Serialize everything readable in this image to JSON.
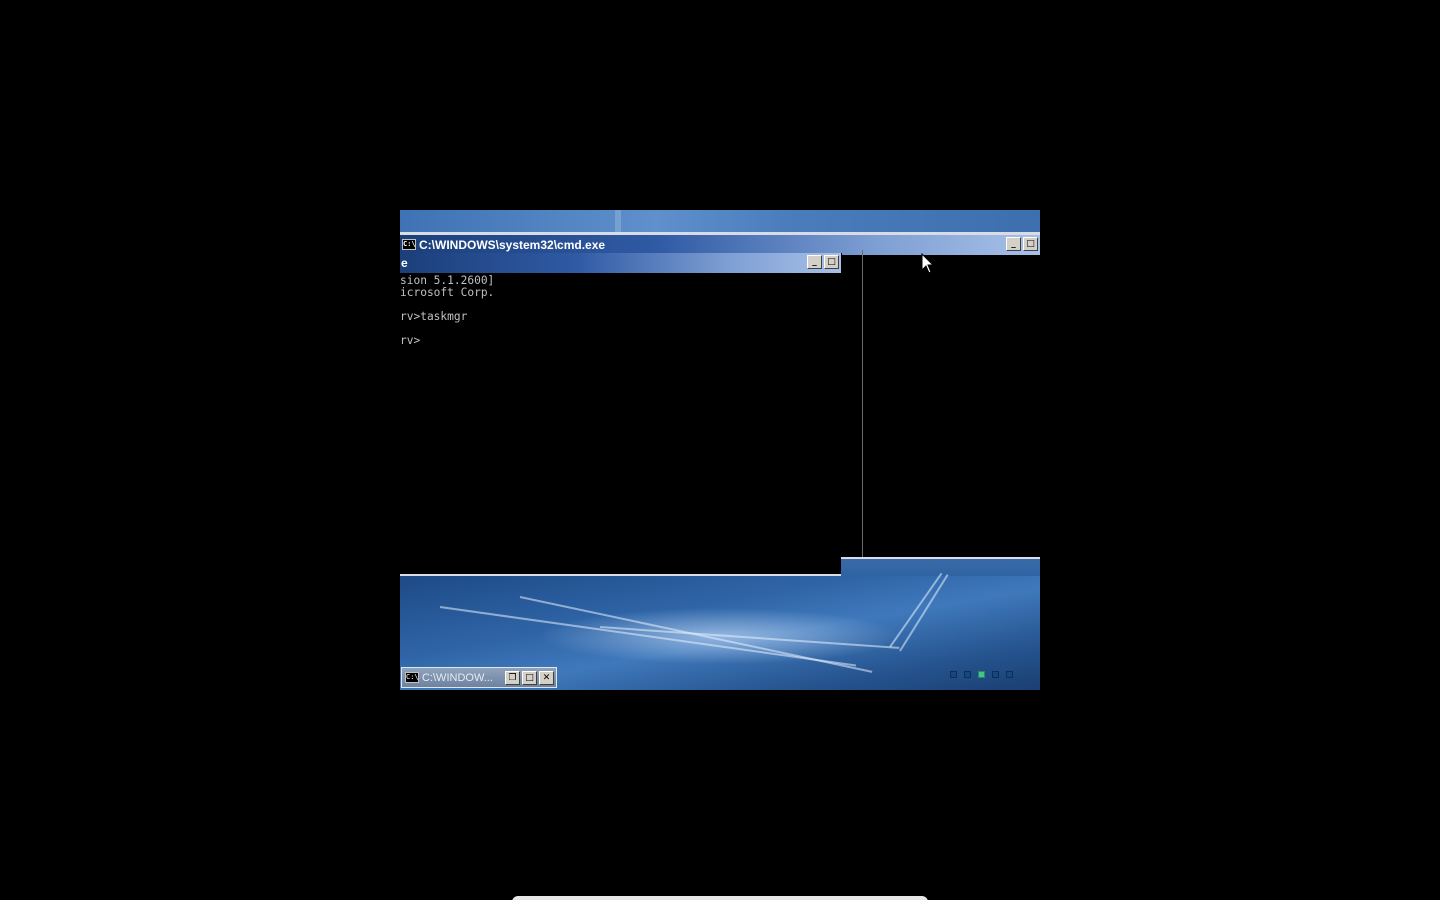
{
  "back_window": {
    "title": "C:\\WINDOWS\\system32\\cmd.exe",
    "icon": "console-icon",
    "icon_label": "C:\\",
    "minimize_label": "_",
    "maximize_label": "□"
  },
  "front_window": {
    "title": "e",
    "icon": "console-icon",
    "minimize_label": "_",
    "maximize_label": "□",
    "console_lines": [
      "sion 5.1.2600]",
      "icrosoft Corp.",
      "",
      "rv>taskmgr",
      "",
      "rv>"
    ]
  },
  "taskbar": {
    "button_label": "C:\\WINDOW...",
    "button_icon": "console-icon",
    "restore_label": "❐",
    "maximize_label": "□",
    "close_label": "✕",
    "tray_indicator_count": 5,
    "tray_active_index": 2
  },
  "colors": {
    "titlebar_start": "#1c3f7a",
    "titlebar_end": "#a7c0e8",
    "console_text": "#c0c0c0",
    "console_bg": "#000000",
    "wallpaper": "#2e64a6",
    "tray_active": "#43c48c"
  }
}
